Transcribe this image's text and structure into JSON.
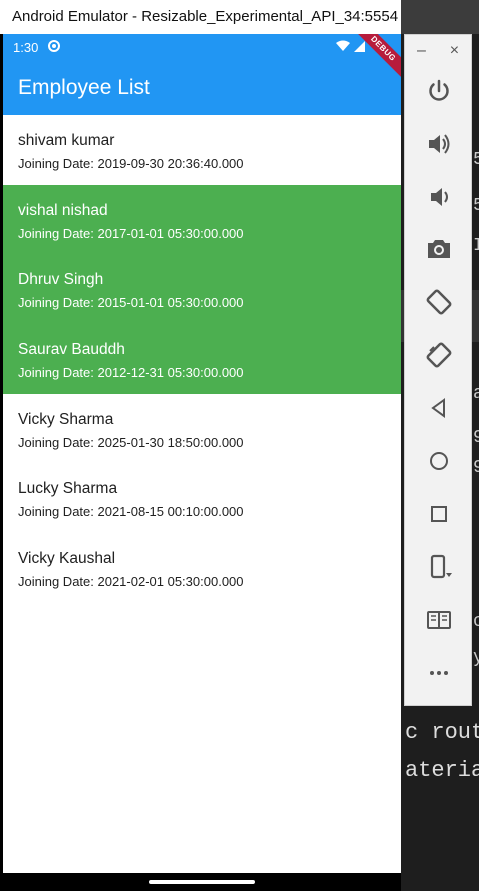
{
  "window": {
    "title": "Android Emulator - Resizable_Experimental_API_34:5554"
  },
  "status_bar": {
    "time": "1:30",
    "debug_label": "DEBUG"
  },
  "app_bar": {
    "title": "Employee List"
  },
  "employees": [
    {
      "name": "shivam kumar",
      "joining": "Joining Date: 2019-09-30 20:36:40.000",
      "highlighted": false
    },
    {
      "name": "vishal nishad",
      "joining": "Joining Date: 2017-01-01 05:30:00.000",
      "highlighted": true
    },
    {
      "name": "Dhruv Singh",
      "joining": "Joining Date: 2015-01-01 05:30:00.000",
      "highlighted": true
    },
    {
      "name": "Saurav Bauddh",
      "joining": "Joining Date: 2012-12-31 05:30:00.000",
      "highlighted": true
    },
    {
      "name": "Vicky Sharma",
      "joining": "Joining Date: 2025-01-30 18:50:00.000",
      "highlighted": false
    },
    {
      "name": "Lucky Sharma",
      "joining": "Joining Date: 2021-08-15 00:10:00.000",
      "highlighted": false
    },
    {
      "name": "Vicky Kaushal",
      "joining": "Joining Date: 2021-02-01 05:30:00.000",
      "highlighted": false
    }
  ],
  "toolbar": {
    "minimize": "–",
    "close": "×",
    "buttons": [
      "power-icon",
      "volume-up-icon",
      "volume-down-icon",
      "camera-icon",
      "rotate-left-icon",
      "rotate-right-icon",
      "back-icon",
      "home-icon",
      "overview-icon",
      "fold-icon",
      "snapshot-icon",
      "more-icon"
    ]
  },
  "terminal": {
    "line1": "c route",
    "line2": "aterial"
  },
  "colors": {
    "primary": "#2196f3",
    "highlight": "#4caf50"
  }
}
